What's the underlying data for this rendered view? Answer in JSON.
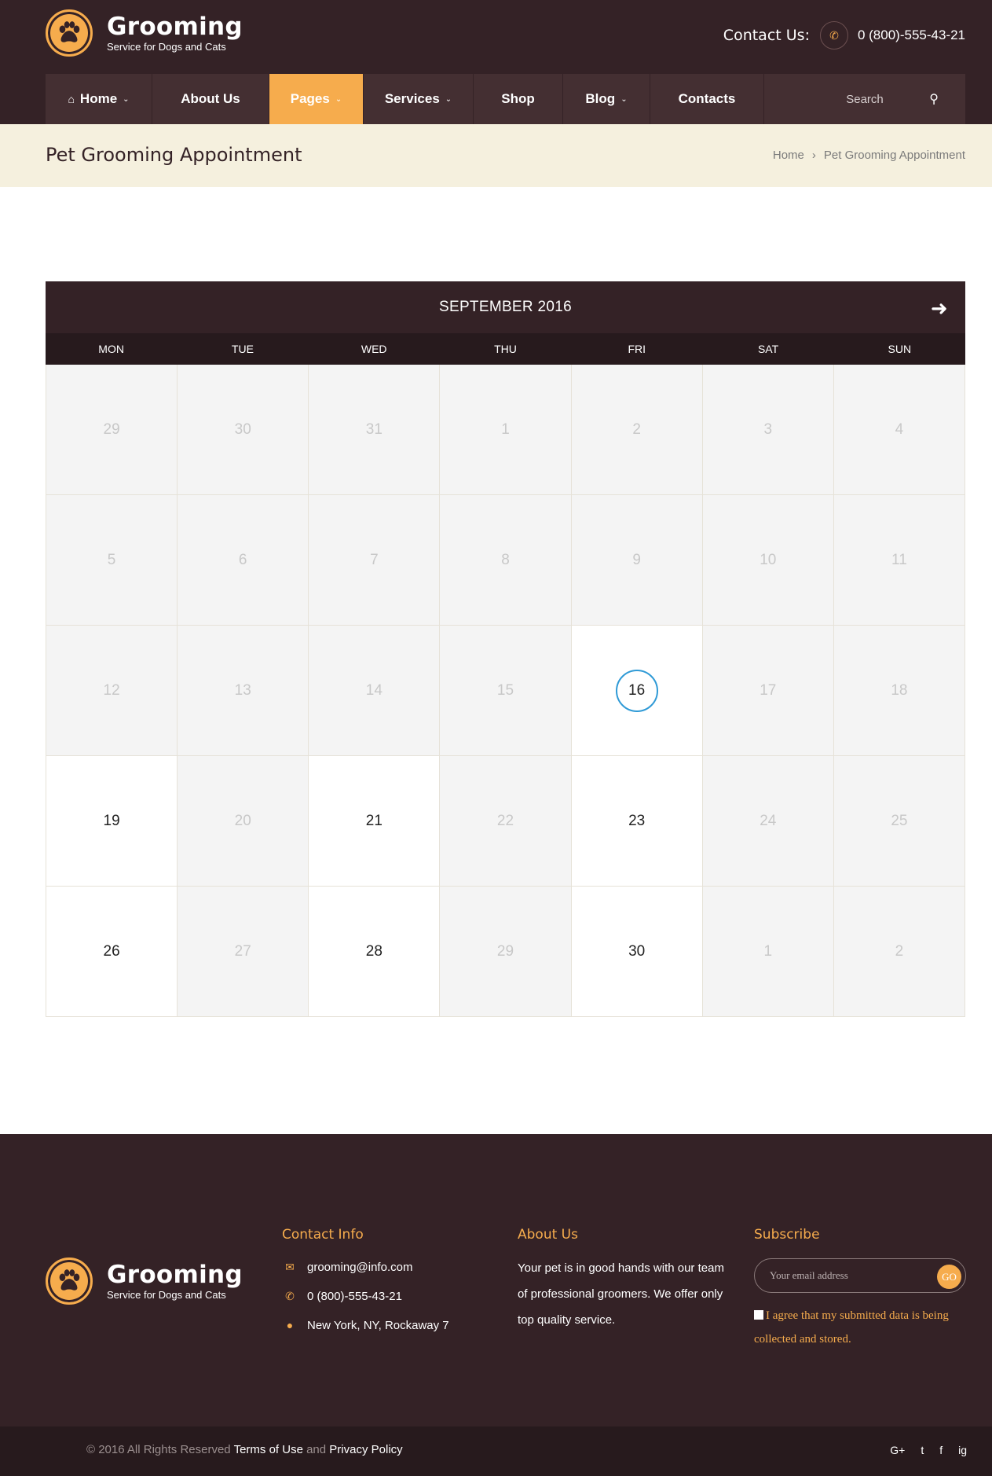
{
  "header": {
    "brand": "Grooming",
    "tagline": "Service for Dogs and Cats",
    "contact_label": "Contact Us:",
    "phone": "0 (800)-555-43-21"
  },
  "nav": {
    "items": [
      {
        "label": "Home"
      },
      {
        "label": "About Us"
      },
      {
        "label": "Pages"
      },
      {
        "label": "Services"
      },
      {
        "label": "Shop"
      },
      {
        "label": "Blog"
      },
      {
        "label": "Contacts"
      }
    ],
    "search_placeholder": "Search"
  },
  "page": {
    "title": "Pet Grooming Appointment",
    "breadcrumb": [
      "Home",
      "Pet Grooming Appointment"
    ]
  },
  "calendar": {
    "month": "SEPTEMBER 2016",
    "weekdays": [
      "MON",
      "TUE",
      "WED",
      "THU",
      "FRI",
      "SAT",
      "SUN"
    ],
    "weeks": [
      [
        "29",
        "30",
        "31",
        "1",
        "2",
        "3",
        "4"
      ],
      [
        "5",
        "6",
        "7",
        "8",
        "9",
        "10",
        "11"
      ],
      [
        "12",
        "13",
        "14",
        "15",
        "16",
        "17",
        "18"
      ],
      [
        "19",
        "20",
        "21",
        "22",
        "23",
        "24",
        "25"
      ],
      [
        "26",
        "27",
        "28",
        "29",
        "30",
        "1",
        "2"
      ]
    ]
  },
  "footer": {
    "brand": "Grooming",
    "tagline": "Service for Dogs and Cats",
    "contact_title": "Contact Info",
    "email": "grooming@info.com",
    "phone": "0 (800)-555-43-21",
    "address": "New York, NY, Rockaway 7",
    "about_title": "About Us",
    "about_text": "Your pet is in good hands with our team of professional groomers. We offer only top quality service.",
    "subscribe_title": "Subscribe",
    "email_placeholder": "Your email address",
    "go_label": "GO",
    "agree_text": "I agree that my submitted data is being collected and stored.",
    "copyright": "© 2016 All Rights Reserved",
    "terms": "Terms of Use",
    "and": "and",
    "privacy": "Privacy Policy",
    "social": [
      "G+",
      "t",
      "f",
      "ig"
    ]
  },
  "colors": {
    "brand_dark": "#342226",
    "accent": "#f6ac4d",
    "title_bar": "#f5f0de",
    "today_ring": "#2f9ad6"
  }
}
